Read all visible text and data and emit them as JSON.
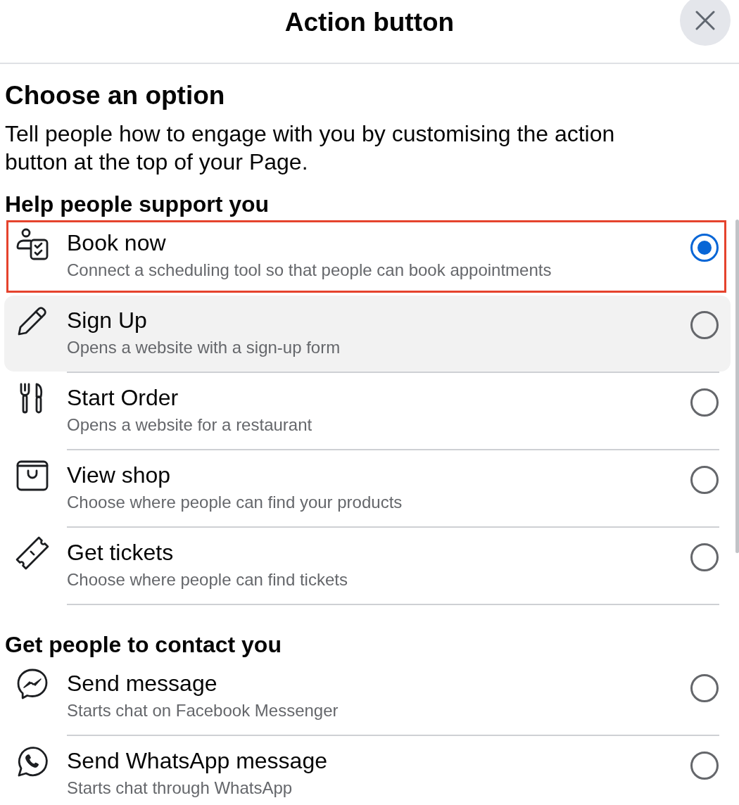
{
  "header": {
    "title": "Action button"
  },
  "intro": {
    "heading": "Choose an option",
    "description": "Tell people how to engage with you by customising the action button at the top of your Page."
  },
  "sections": [
    {
      "heading": "Help people support you",
      "options": [
        {
          "kind": "booking",
          "title": "Book now",
          "subtitle": "Connect a scheduling tool so that people can book appointments",
          "selected": true,
          "highlighted": true,
          "hovered": false
        },
        {
          "kind": "signup",
          "title": "Sign Up",
          "subtitle": "Opens a website with a sign-up form",
          "selected": false,
          "highlighted": false,
          "hovered": true
        },
        {
          "kind": "order",
          "title": "Start Order",
          "subtitle": "Opens a website for a restaurant",
          "selected": false,
          "highlighted": false,
          "hovered": false
        },
        {
          "kind": "shop",
          "title": "View shop",
          "subtitle": "Choose where people can find your products",
          "selected": false,
          "highlighted": false,
          "hovered": false
        },
        {
          "kind": "tickets",
          "title": "Get tickets",
          "subtitle": "Choose where people can find tickets",
          "selected": false,
          "highlighted": false,
          "hovered": false
        }
      ]
    },
    {
      "heading": "Get people to contact you",
      "options": [
        {
          "kind": "messenger",
          "title": "Send message",
          "subtitle": "Starts chat on Facebook Messenger",
          "selected": false,
          "highlighted": false,
          "hovered": false
        },
        {
          "kind": "whatsapp",
          "title": "Send WhatsApp message",
          "subtitle": "Starts chat through WhatsApp",
          "selected": false,
          "highlighted": false,
          "hovered": false
        }
      ]
    }
  ]
}
